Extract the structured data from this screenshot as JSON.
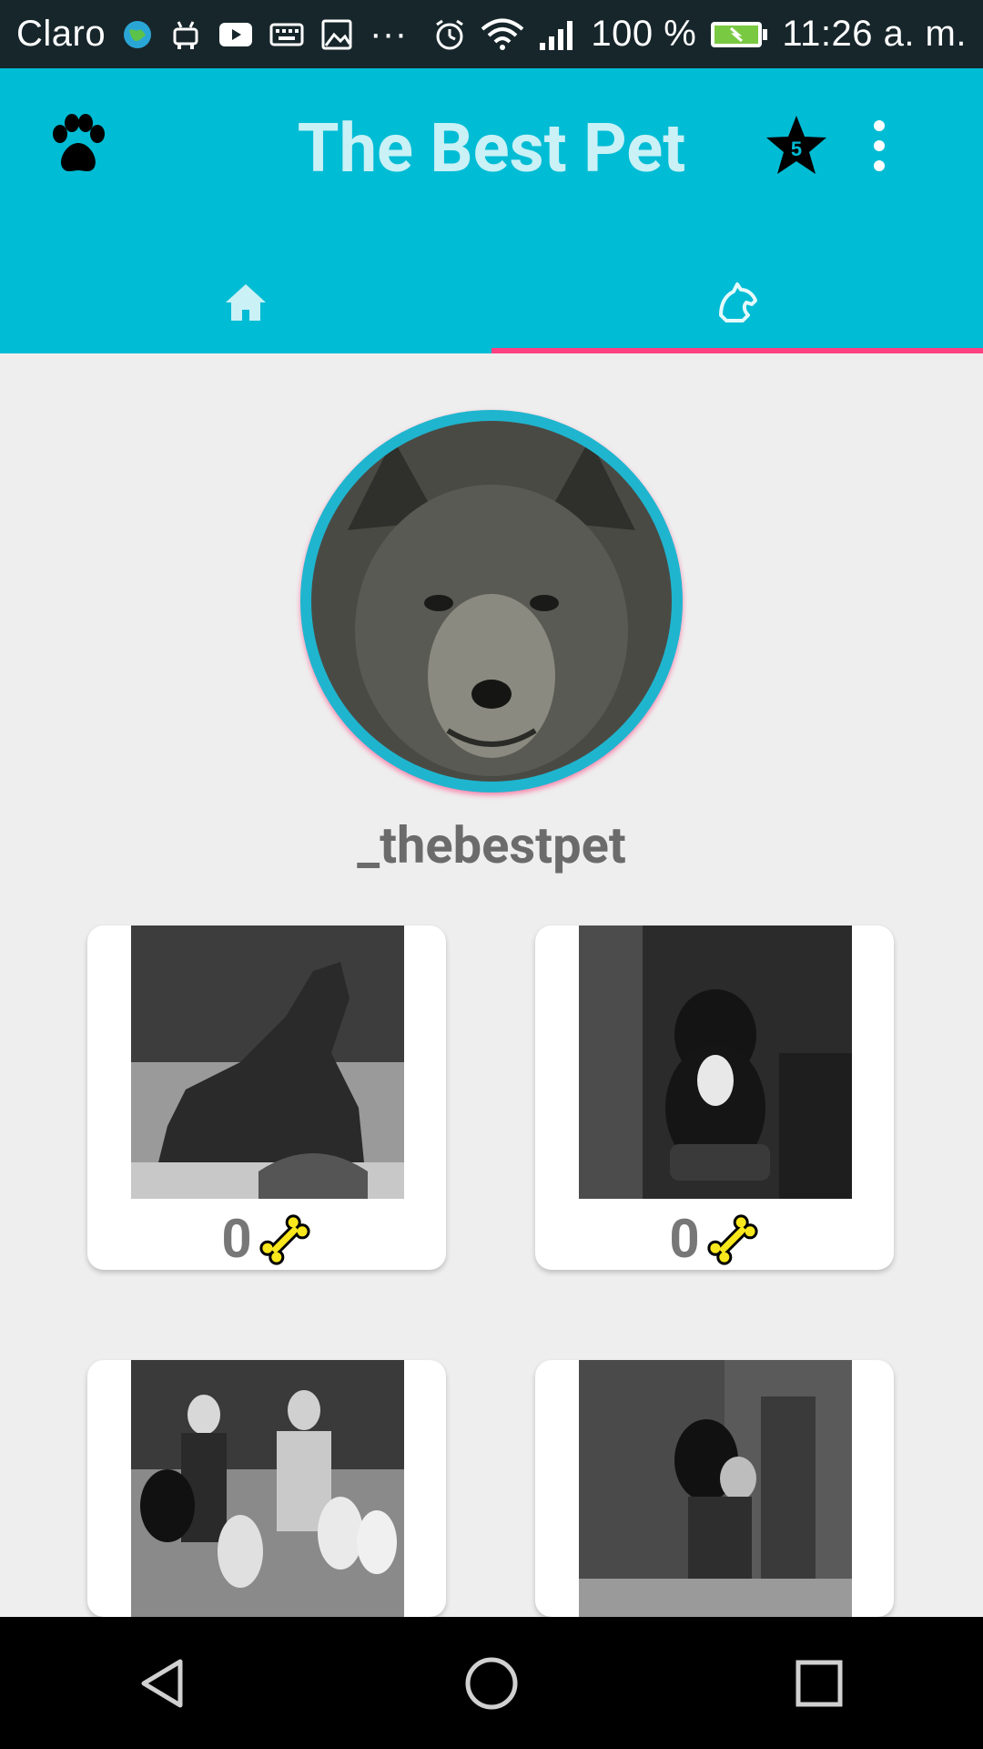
{
  "status_bar": {
    "carrier": "Claro",
    "more_indicator": "···",
    "battery_percent": "100 %",
    "time": "11:26 a. m."
  },
  "app_bar": {
    "title": "The Best Pet",
    "favorites_count": "5",
    "tabs": [
      {
        "icon": "home-icon",
        "selected": false
      },
      {
        "icon": "dog-icon",
        "selected": true
      }
    ]
  },
  "profile": {
    "username": "_thebestpet"
  },
  "posts": [
    {
      "likes": "0",
      "desc": "statue photo"
    },
    {
      "likes": "0",
      "desc": "dog on cushion photo"
    },
    {
      "likes": "",
      "desc": "men with dogs photo"
    },
    {
      "likes": "",
      "desc": "person holding dog photo"
    }
  ],
  "colors": {
    "primary": "#00bcd4",
    "accent": "#ff4081",
    "title": "#c9f1f6",
    "background": "#eeeeee"
  }
}
